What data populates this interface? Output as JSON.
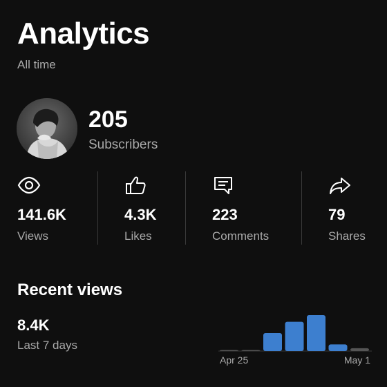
{
  "header": {
    "title": "Analytics",
    "period": "All time"
  },
  "channel": {
    "avatar_icon": "channel-avatar",
    "subscribers_count": "205",
    "subscribers_label": "Subscribers"
  },
  "stats": [
    {
      "icon": "eye-icon",
      "value": "141.6K",
      "label": "Views"
    },
    {
      "icon": "thumbs-up-icon",
      "value": "4.3K",
      "label": "Likes"
    },
    {
      "icon": "comment-icon",
      "value": "223",
      "label": "Comments"
    },
    {
      "icon": "share-icon",
      "value": "79",
      "label": "Shares"
    }
  ],
  "recent": {
    "title": "Recent views",
    "value": "8.4K",
    "label": "Last 7 days"
  },
  "chart_data": {
    "type": "bar",
    "x_tick_labels": [
      "Apr 25",
      "May 1"
    ],
    "values": [
      0.1,
      0.1,
      1.9,
      3.1,
      3.8,
      0.7,
      0.3
    ],
    "bar_color": "#3d7fcf",
    "baseline_color": "#3a3a3a"
  }
}
